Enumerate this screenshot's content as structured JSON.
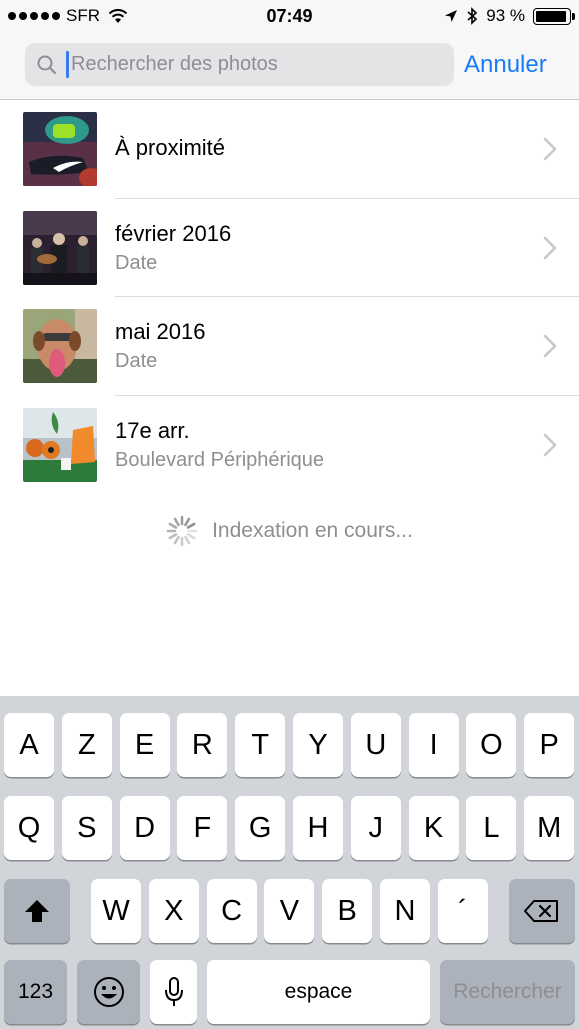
{
  "status_bar": {
    "carrier": "SFR",
    "time": "07:49",
    "battery_percent": "93 %",
    "battery_level": 0.93
  },
  "search": {
    "placeholder": "Rechercher des photos",
    "value": "",
    "cancel_label": "Annuler"
  },
  "results": [
    {
      "title": "À proximité",
      "subtitle": ""
    },
    {
      "title": "février 2016",
      "subtitle": "Date"
    },
    {
      "title": "mai 2016",
      "subtitle": "Date"
    },
    {
      "title": "17e arr.",
      "subtitle": "Boulevard Périphérique"
    }
  ],
  "indexing_text": "Indexation en cours...",
  "keyboard": {
    "row1": [
      "A",
      "Z",
      "E",
      "R",
      "T",
      "Y",
      "U",
      "I",
      "O",
      "P"
    ],
    "row2": [
      "Q",
      "S",
      "D",
      "F",
      "G",
      "H",
      "J",
      "K",
      "L",
      "M"
    ],
    "row3": [
      "W",
      "X",
      "C",
      "V",
      "B",
      "N",
      "´"
    ],
    "numbers_key": "123",
    "space_key": "espace",
    "return_key": "Rechercher"
  },
  "colors": {
    "accent": "#1a7cf5",
    "secondary_text": "#8e8e93",
    "keyboard_bg": "#d1d4d9"
  },
  "icons": [
    "location-arrow-icon",
    "bluetooth-icon",
    "wifi-icon",
    "search-icon",
    "chevron-right-icon",
    "spinner-icon",
    "shift-icon",
    "backspace-icon",
    "emoji-icon",
    "microphone-icon"
  ]
}
